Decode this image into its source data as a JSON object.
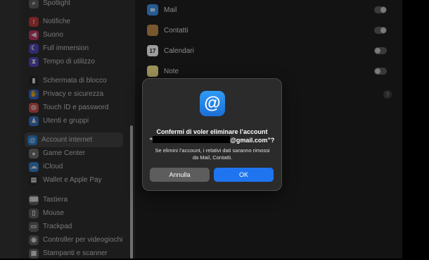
{
  "sidebar": {
    "items": [
      {
        "label": "Spotlight",
        "icon": "magnifier-icon",
        "color": "#6b6b6b",
        "glyph": "⌕"
      },
      {
        "label": "Notifiche",
        "icon": "bell-icon",
        "color": "#d04040",
        "glyph": "!"
      },
      {
        "label": "Suono",
        "icon": "speaker-icon",
        "color": "#d04070",
        "glyph": "◀"
      },
      {
        "label": "Full immersion",
        "icon": "moon-icon",
        "color": "#5a4fcf",
        "glyph": "☾"
      },
      {
        "label": "Tempo di utilizzo",
        "icon": "hourglass-icon",
        "color": "#5a4fcf",
        "glyph": "⧗"
      },
      {
        "label": "Schermata di blocco",
        "icon": "lock-screen-icon",
        "color": "#2b2b2b",
        "glyph": "▮"
      },
      {
        "label": "Privacy e sicurezza",
        "icon": "hand-icon",
        "color": "#3d6fd6",
        "glyph": "✋"
      },
      {
        "label": "Touch ID e password",
        "icon": "fingerprint-icon",
        "color": "#e05555",
        "glyph": "◎"
      },
      {
        "label": "Utenti e gruppi",
        "icon": "users-icon",
        "color": "#3d7ad6",
        "glyph": "♟"
      },
      {
        "label": "Account internet",
        "icon": "at-icon",
        "color": "#2f8de8",
        "glyph": "@"
      },
      {
        "label": "Game Center",
        "icon": "game-center-icon",
        "color": "#7a7a7a",
        "glyph": "●"
      },
      {
        "label": "iCloud",
        "icon": "cloud-icon",
        "color": "#3d8de0",
        "glyph": "☁"
      },
      {
        "label": "Wallet e Apple Pay",
        "icon": "wallet-icon",
        "color": "#2b2b2b",
        "glyph": "▤"
      },
      {
        "label": "Tastiera",
        "icon": "keyboard-icon",
        "color": "#6b6b6b",
        "glyph": "⌨"
      },
      {
        "label": "Mouse",
        "icon": "mouse-icon",
        "color": "#6b6b6b",
        "glyph": "▯"
      },
      {
        "label": "Trackpad",
        "icon": "trackpad-icon",
        "color": "#6b6b6b",
        "glyph": "▭"
      },
      {
        "label": "Controller per videogiochi",
        "icon": "gamepad-icon",
        "color": "#6b6b6b",
        "glyph": "◉"
      },
      {
        "label": "Stampanti e scanner",
        "icon": "printer-icon",
        "color": "#6b6b6b",
        "glyph": "▦"
      }
    ]
  },
  "services": [
    {
      "label": "Mail",
      "icon": "mail-icon",
      "color": "#3d8de0",
      "enabled": true
    },
    {
      "label": "Contatti",
      "icon": "contacts-icon",
      "color": "#b8864a",
      "enabled": true
    },
    {
      "label": "Calendari",
      "icon": "calendar-icon",
      "color": "#f2f2f2",
      "enabled": false,
      "badge": "17"
    },
    {
      "label": "Note",
      "icon": "notes-icon",
      "color": "#f2e08a",
      "enabled": false
    }
  ],
  "help": {
    "label": "?"
  },
  "dialog": {
    "icon_glyph": "@",
    "title_line1": "Confermi di voler eliminare l’account",
    "title_prefix": "“",
    "title_suffix": "@gmail.com”?",
    "body": "Se elimini l’account, i relativi dati saranno rimossi da Mail, Contatti.",
    "cancel_label": "Annulla",
    "ok_label": "OK",
    "accent": "#1f75f0"
  }
}
